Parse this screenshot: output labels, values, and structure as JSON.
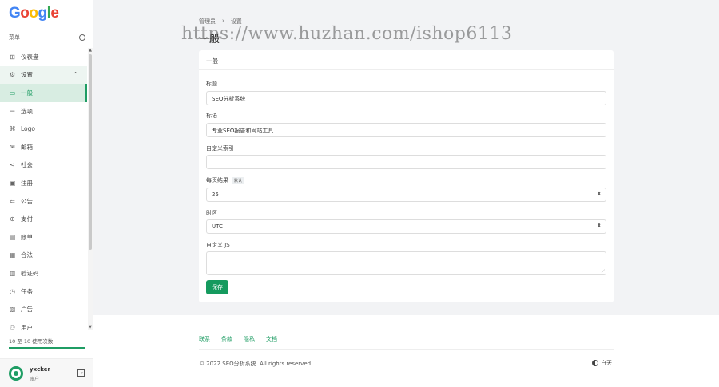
{
  "brand": {
    "logo_letters": [
      "G",
      "o",
      "o",
      "g",
      "l",
      "e"
    ],
    "logo_colors": [
      "#4285F4",
      "#EA4335",
      "#FBBC05",
      "#4285F4",
      "#34A853",
      "#EA4335"
    ]
  },
  "sidebar": {
    "menu_label": "菜单",
    "items": [
      {
        "icon": "grid-icon",
        "glyph": "⊞",
        "label": "仪表盘"
      },
      {
        "icon": "gear-icon",
        "glyph": "⚙",
        "label": "设置",
        "group": true
      },
      {
        "icon": "window-icon",
        "glyph": "▭",
        "label": "一般",
        "active": true
      },
      {
        "icon": "sliders-icon",
        "glyph": "☰",
        "label": "选项"
      },
      {
        "icon": "logo-icon",
        "glyph": "⌘",
        "label": "Logo"
      },
      {
        "icon": "mail-icon",
        "glyph": "✉",
        "label": "邮箱"
      },
      {
        "icon": "share-icon",
        "glyph": "<",
        "label": "社会"
      },
      {
        "icon": "id-card-icon",
        "glyph": "▣",
        "label": "注册"
      },
      {
        "icon": "megaphone-icon",
        "glyph": "⇐",
        "label": "公告"
      },
      {
        "icon": "globe-icon",
        "glyph": "⊕",
        "label": "支付"
      },
      {
        "icon": "invoice-icon",
        "glyph": "▤",
        "label": "账单"
      },
      {
        "icon": "legal-icon",
        "glyph": "▦",
        "label": "合法"
      },
      {
        "icon": "captcha-icon",
        "glyph": "▥",
        "label": "验证码"
      },
      {
        "icon": "clock-icon",
        "glyph": "◷",
        "label": "任务"
      },
      {
        "icon": "ad-icon",
        "glyph": "▧",
        "label": "广告"
      },
      {
        "icon": "users-icon",
        "glyph": "⚇",
        "label": "用户"
      }
    ],
    "usage_text": "10 至 10 使用次数",
    "usage_fraction": 1.0,
    "user": {
      "name": "yxcker",
      "role": "账户"
    }
  },
  "breadcrumb": {
    "parent": "管理员",
    "separator": "›",
    "current": "设置"
  },
  "page": {
    "title": "一般"
  },
  "watermark": "https://www.huzhan.com/ishop6113",
  "form": {
    "card_title": "一般",
    "title_label": "标题",
    "title_value": "SEO分析系统",
    "tagline_label": "标语",
    "tagline_value": "专业SEO报告和网站工具",
    "custom_index_label": "自定义索引",
    "custom_index_value": "",
    "per_page_label": "每页结果",
    "per_page_badge": "默认",
    "per_page_value": "25",
    "timezone_label": "时区",
    "timezone_value": "UTC",
    "custom_js_label": "自定义 JS",
    "save_label": "保存"
  },
  "footer": {
    "links": [
      "联系",
      "条款",
      "隐私",
      "文档"
    ],
    "copyright": "© 2022 SEO分析系统. All rights reserved.",
    "theme_label": "白天"
  },
  "colors": {
    "accent": "#1f9d64",
    "button": "#159a5e"
  }
}
